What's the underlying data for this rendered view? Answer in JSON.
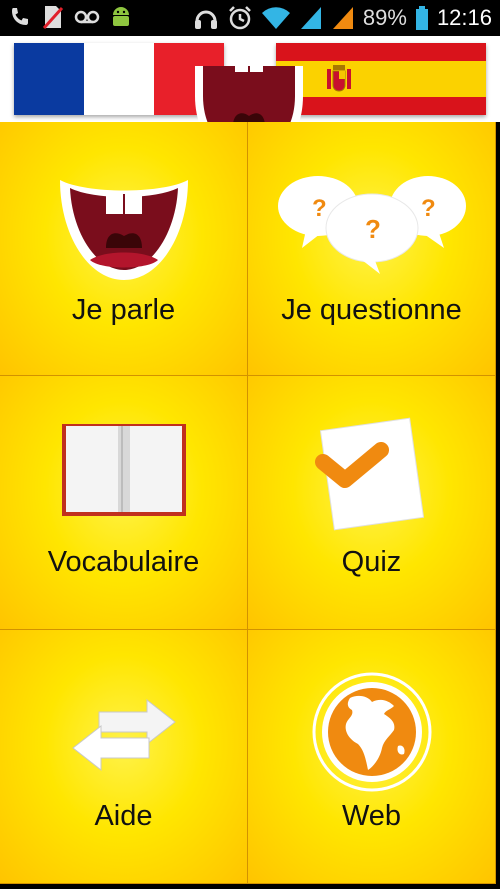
{
  "status_bar": {
    "battery": "89%",
    "time": "12:16",
    "icons": [
      "phone-icon",
      "no-sim-icon",
      "voicemail-icon",
      "android-icon",
      "headset-icon",
      "alarm-icon",
      "wifi-icon",
      "signal-icon",
      "signal-orange-icon",
      "battery-icon"
    ]
  },
  "header": {
    "left_flag": "france-flag",
    "right_flag": "spain-flag",
    "logo": "mouth-logo-icon"
  },
  "menu": [
    {
      "label": "Je parle",
      "icon": "mouth-icon"
    },
    {
      "label": "Je questionne",
      "icon": "speech-bubbles-icon"
    },
    {
      "label": "Vocabulaire",
      "icon": "book-icon"
    },
    {
      "label": "Quiz",
      "icon": "checkmark-paper-icon"
    },
    {
      "label": "Aide",
      "icon": "arrows-icon"
    },
    {
      "label": "Web",
      "icon": "globe-icon"
    }
  ],
  "colors": {
    "tile_yellow": "#ffe600",
    "tile_orange": "#ffc400",
    "accent_orange": "#f08a10",
    "mouth_red": "#8b0a1e",
    "france_blue": "#0a3aa0",
    "france_red": "#e8202a",
    "spain_red": "#d9131b",
    "spain_yellow": "#fbd200"
  }
}
